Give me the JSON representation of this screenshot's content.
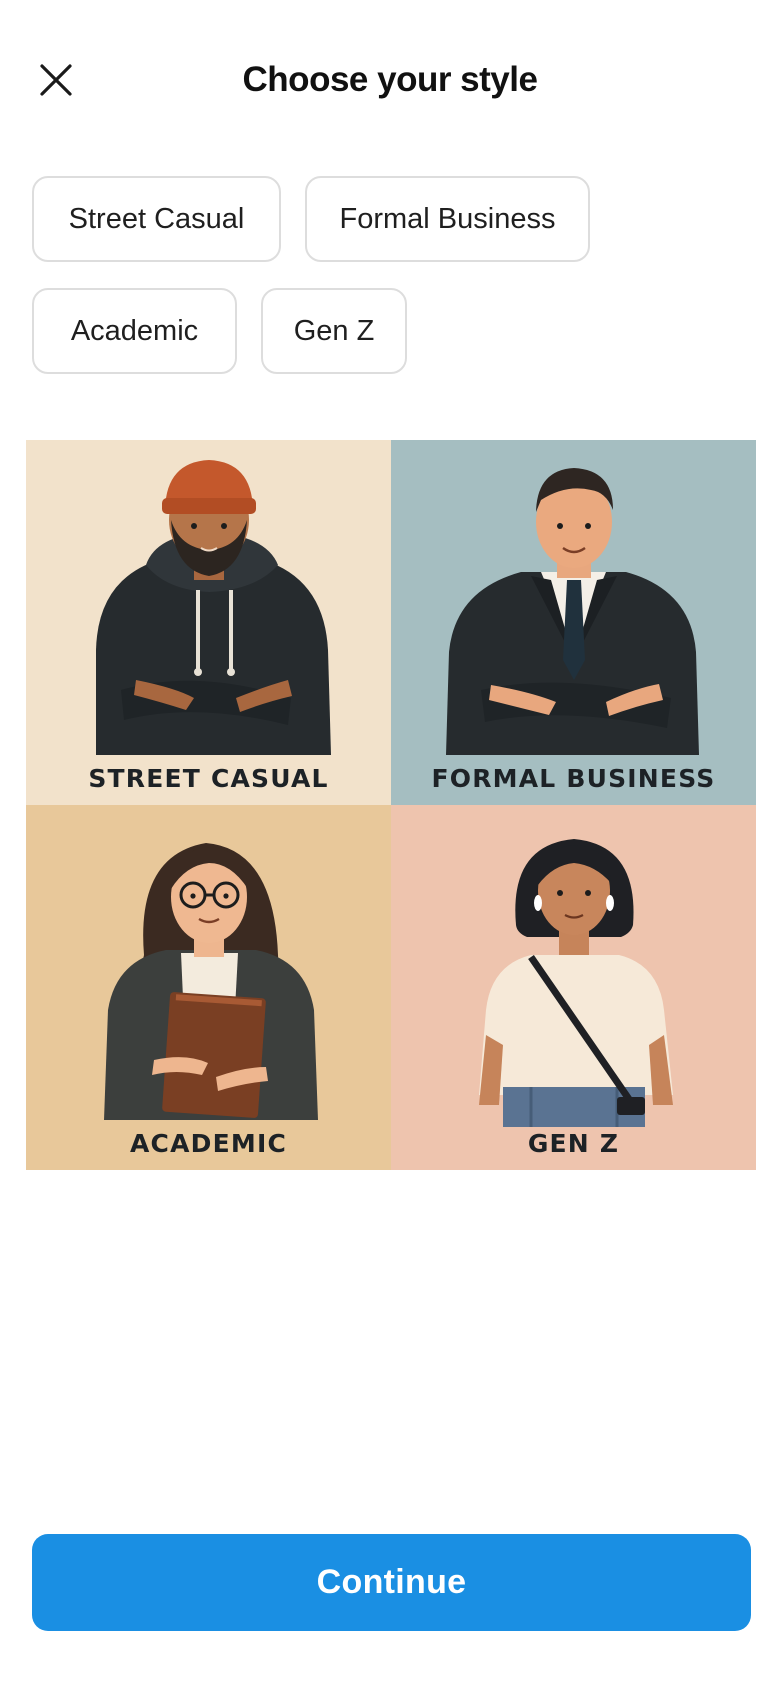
{
  "header": {
    "title": "Choose your style",
    "close_icon": "close-icon"
  },
  "chips": [
    {
      "label": "Street Casual"
    },
    {
      "label": "Formal Business"
    },
    {
      "label": "Academic"
    },
    {
      "label": "Gen Z"
    }
  ],
  "grid": {
    "tiles": [
      {
        "label": "STREET CASUAL",
        "background": "#f2e2cb"
      },
      {
        "label": "FORMAL BUSINESS",
        "background": "#a5bec1"
      },
      {
        "label": "ACADEMIC",
        "background": "#e8c89a"
      },
      {
        "label": "GEN Z",
        "background": "#eec4ae"
      }
    ]
  },
  "footer": {
    "continue_label": "Continue",
    "accent": "#1a8fe3"
  }
}
